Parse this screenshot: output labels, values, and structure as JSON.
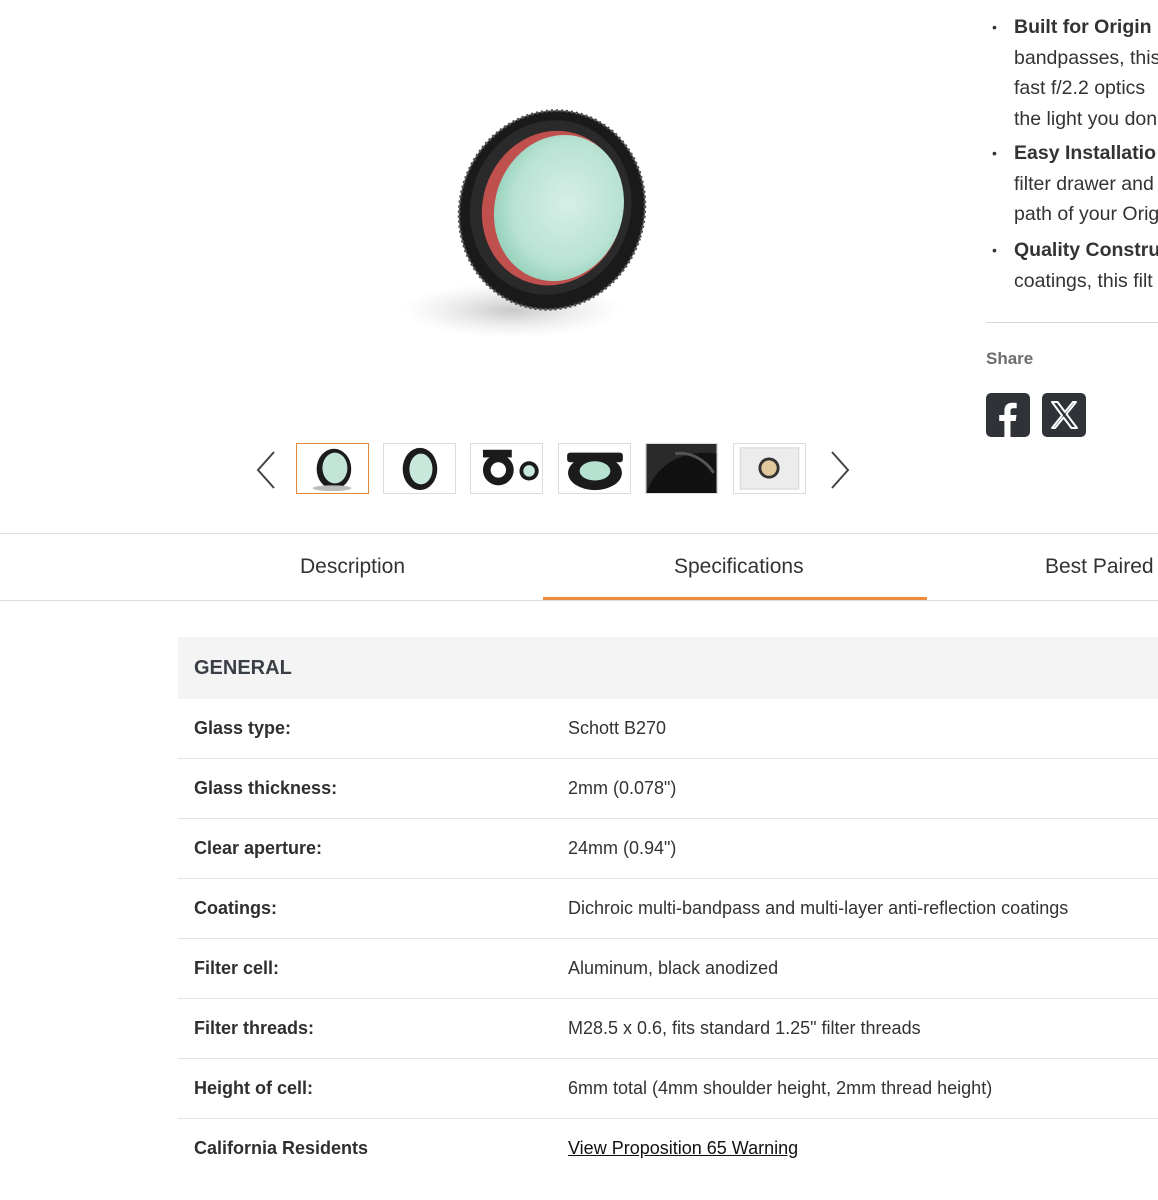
{
  "gallery": {
    "thumbnail_count": 6,
    "active_index": 0,
    "main_image_icon": "nebula-filter-product-image"
  },
  "features": [
    {
      "title": "Built for Origin",
      "lines": [
        "bandpasses, this",
        "fast f/2.2 optics",
        "the light you don"
      ]
    },
    {
      "title": "Easy Installatio",
      "lines": [
        "filter drawer and",
        "path of your Orig"
      ]
    },
    {
      "title": "Quality Constru",
      "lines": [
        "coatings, this filt"
      ]
    }
  ],
  "share": {
    "label": "Share",
    "facebook_icon": "facebook-icon",
    "x_icon": "x-icon"
  },
  "tabs": [
    {
      "label": "Description"
    },
    {
      "label": "Specifications",
      "active": true
    },
    {
      "label": "Best Paired W"
    }
  ],
  "accent_color": "#ec8a3d",
  "specs": {
    "section_title": "GENERAL",
    "rows": [
      {
        "label": "Glass type:",
        "value": "Schott B270"
      },
      {
        "label": "Glass thickness:",
        "value": "2mm (0.078\")"
      },
      {
        "label": "Clear aperture:",
        "value": "24mm (0.94\")"
      },
      {
        "label": "Coatings:",
        "value": "Dichroic multi-bandpass and multi-layer anti-reflection coatings"
      },
      {
        "label": "Filter cell:",
        "value": "Aluminum, black anodized"
      },
      {
        "label": "Filter threads:",
        "value": "M28.5 x 0.6, fits standard 1.25\" filter threads"
      },
      {
        "label": "Height of cell:",
        "value": "6mm total (4mm shoulder height, 2mm thread height)"
      },
      {
        "label": "California Residents",
        "value": "View Proposition 65 Warning",
        "is_link": true
      }
    ]
  }
}
